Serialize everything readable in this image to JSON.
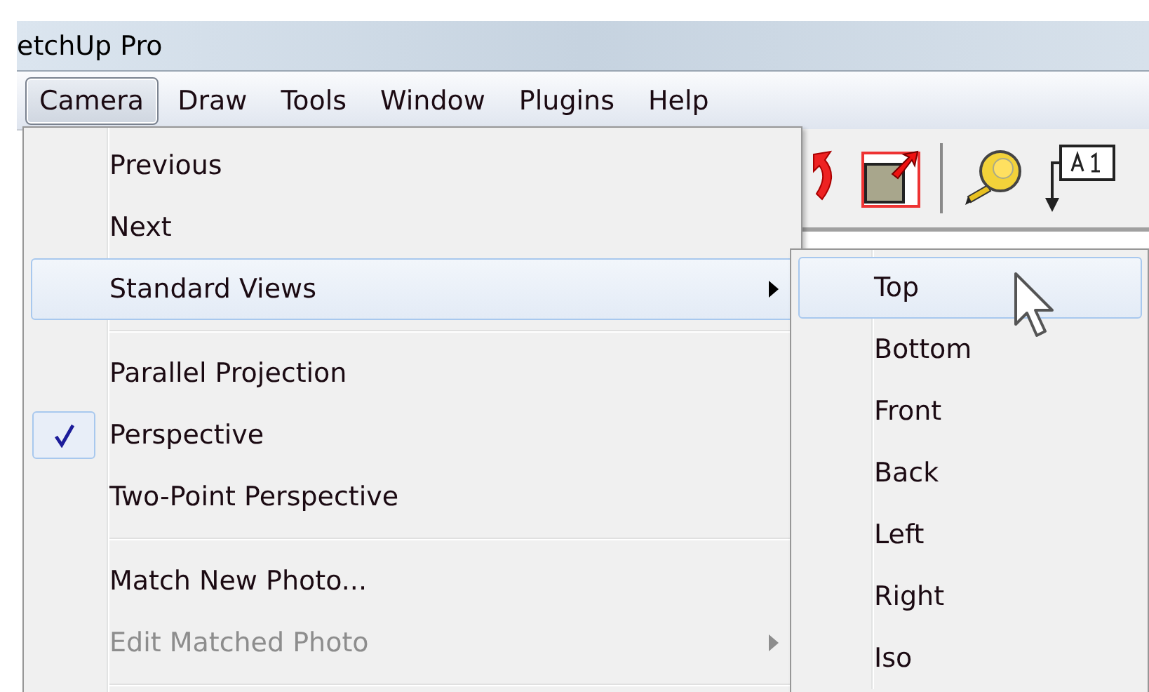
{
  "window": {
    "title": "etchUp Pro"
  },
  "menubar": [
    {
      "label": "Camera",
      "selected": true
    },
    {
      "label": "Draw",
      "selected": false
    },
    {
      "label": "Tools",
      "selected": false
    },
    {
      "label": "Window",
      "selected": false
    },
    {
      "label": "Plugins",
      "selected": false
    },
    {
      "label": "Help",
      "selected": false
    }
  ],
  "camera_menu": [
    {
      "kind": "item",
      "label": "Previous",
      "selected": false,
      "checked": false,
      "disabled": false,
      "submenu": false
    },
    {
      "kind": "item",
      "label": "Next",
      "selected": false,
      "checked": false,
      "disabled": false,
      "submenu": false
    },
    {
      "kind": "item",
      "label": "Standard Views",
      "selected": true,
      "checked": false,
      "disabled": false,
      "submenu": true
    },
    {
      "kind": "separator"
    },
    {
      "kind": "item",
      "label": "Parallel Projection",
      "selected": false,
      "checked": false,
      "disabled": false,
      "submenu": false
    },
    {
      "kind": "item",
      "label": "Perspective",
      "selected": false,
      "checked": true,
      "disabled": false,
      "submenu": false
    },
    {
      "kind": "item",
      "label": "Two-Point Perspective",
      "selected": false,
      "checked": false,
      "disabled": false,
      "submenu": false
    },
    {
      "kind": "separator"
    },
    {
      "kind": "item",
      "label": "Match New Photo...",
      "selected": false,
      "checked": false,
      "disabled": false,
      "submenu": false
    },
    {
      "kind": "item",
      "label": "Edit Matched Photo",
      "selected": false,
      "checked": false,
      "disabled": true,
      "submenu": true
    },
    {
      "kind": "separator"
    }
  ],
  "standard_views_menu": [
    {
      "label": "Top",
      "selected": true
    },
    {
      "label": "Bottom",
      "selected": false
    },
    {
      "label": "Front",
      "selected": false
    },
    {
      "label": "Back",
      "selected": false
    },
    {
      "label": "Left",
      "selected": false
    },
    {
      "label": "Right",
      "selected": false
    },
    {
      "label": "Iso",
      "selected": false
    }
  ]
}
